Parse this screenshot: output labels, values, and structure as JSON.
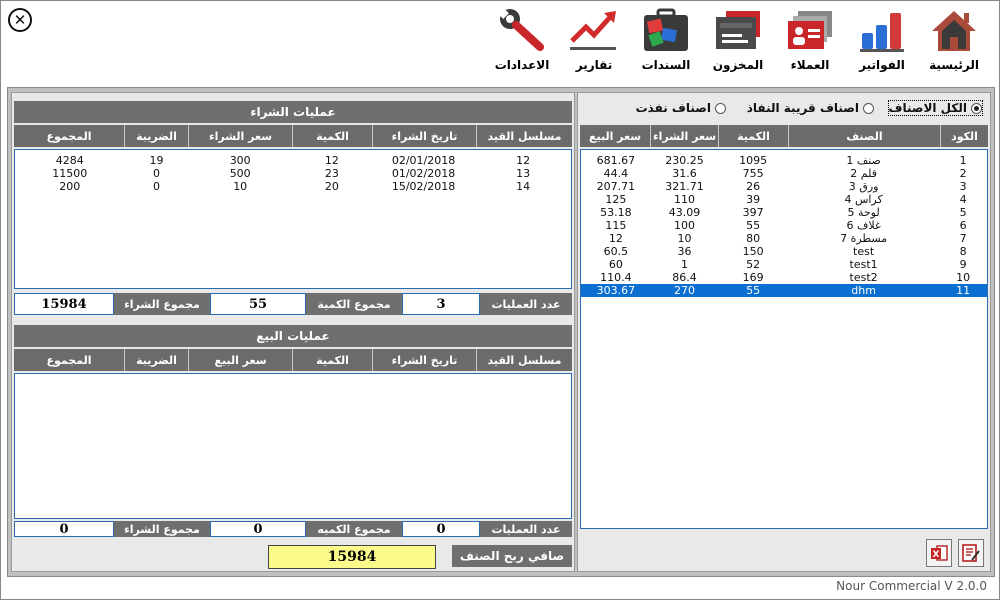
{
  "toolbar": {
    "items": [
      {
        "label": "الرئيسية",
        "icon": "home-icon"
      },
      {
        "label": "الفواتير",
        "icon": "bar-chart-icon"
      },
      {
        "label": "العملاء",
        "icon": "users-card-icon"
      },
      {
        "label": "المخزون",
        "icon": "inventory-icon"
      },
      {
        "label": "السندات",
        "icon": "briefcase-icon"
      },
      {
        "label": "تقارير",
        "icon": "trend-icon"
      },
      {
        "label": "الاعدادات",
        "icon": "wrench-icon"
      }
    ]
  },
  "purchases": {
    "title": "عمليات الشراء",
    "columns": [
      "مسلسل القيد",
      "تاريخ الشراء",
      "الكمية",
      "سعر الشراء",
      "الضريبة",
      "المجموع"
    ],
    "rows": [
      [
        "12",
        "02/01/2018",
        "12",
        "300",
        "19",
        "4284"
      ],
      [
        "13",
        "01/02/2018",
        "23",
        "500",
        "0",
        "11500"
      ],
      [
        "14",
        "15/02/2018",
        "20",
        "10",
        "0",
        "200"
      ]
    ],
    "summary": {
      "count_label": "عدد العمليات",
      "count_value": "3",
      "qty_label": "مجموع الكمية",
      "qty_value": "55",
      "total_label": "مجموع الشراء",
      "total_value": "15984"
    }
  },
  "sales": {
    "title": "عمليات البيع",
    "columns": [
      "مسلسل القيد",
      "تاريخ الشراء",
      "الكمية",
      "سعر البيع",
      "الضريبة",
      "المجموع"
    ],
    "summary": {
      "count_label": "عدد العمليات",
      "count_value": "0",
      "qty_label": "مجموع الكميه",
      "qty_value": "0",
      "total_label": "مجموع الشراء",
      "total_value": "0"
    }
  },
  "profit": {
    "label": "صافي ربح الصنف",
    "value": "15984"
  },
  "filters": {
    "all": "الكل الاصناف",
    "near_out": "اصناف قريبة النفاذ",
    "out": "اصناف نفذت"
  },
  "items_table": {
    "columns": [
      "الكود",
      "الصنف",
      "الكمية",
      "سعر الشراء",
      "سعر البيع"
    ],
    "rows": [
      [
        "1",
        "صنف 1",
        "1095",
        "230.25",
        "681.67"
      ],
      [
        "2",
        "قلم 2",
        "755",
        "31.6",
        "44.4"
      ],
      [
        "3",
        "ورق 3",
        "26",
        "321.71",
        "207.71"
      ],
      [
        "4",
        "كراس 4",
        "39",
        "110",
        "125"
      ],
      [
        "5",
        "لوحة 5",
        "397",
        "43.09",
        "53.18"
      ],
      [
        "6",
        "غلاف 6",
        "55",
        "100",
        "115"
      ],
      [
        "7",
        "مسطرة 7",
        "80",
        "10",
        "12"
      ],
      [
        "8",
        "test",
        "150",
        "36",
        "60.5"
      ],
      [
        "9",
        "test1",
        "52",
        "1",
        "60"
      ],
      [
        "10",
        "test2",
        "169",
        "86.4",
        "110.4"
      ],
      [
        "11",
        "dhm",
        "55",
        "270",
        "303.67"
      ]
    ],
    "selected_index": 10
  },
  "version": "Nour Commercial V 2.0.0"
}
